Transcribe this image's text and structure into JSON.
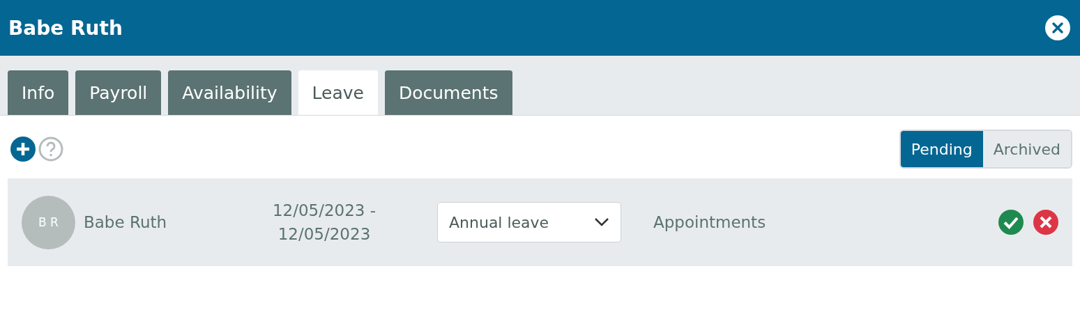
{
  "window": {
    "title": "Babe Ruth"
  },
  "tabs": [
    {
      "label": "Info",
      "selected": false
    },
    {
      "label": "Payroll",
      "selected": false
    },
    {
      "label": "Availability",
      "selected": false
    },
    {
      "label": "Leave",
      "selected": true
    },
    {
      "label": "Documents",
      "selected": false
    }
  ],
  "filter": [
    {
      "label": "Pending",
      "selected": true
    },
    {
      "label": "Archived",
      "selected": false
    }
  ],
  "requests": [
    {
      "initials": "B R",
      "name": "Babe Ruth",
      "date_from": "12/05/2023 -",
      "date_to": "12/05/2023",
      "leave_type": "Annual leave",
      "reason": "Appointments"
    }
  ]
}
